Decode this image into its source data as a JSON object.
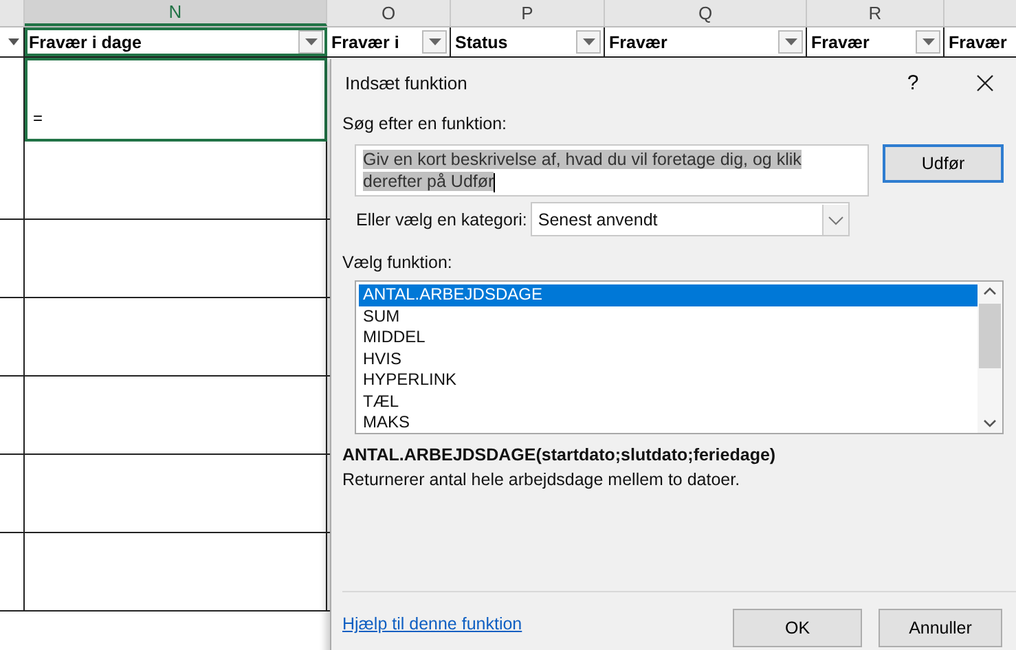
{
  "sheet": {
    "column_letters": [
      {
        "letter": "N",
        "selected": true
      },
      {
        "letter": "O",
        "selected": false
      },
      {
        "letter": "P",
        "selected": false
      },
      {
        "letter": "Q",
        "selected": false
      },
      {
        "letter": "R",
        "selected": false
      }
    ],
    "headers": [
      {
        "label": "Fravær i dage",
        "selected": true
      },
      {
        "label": "Fravær i",
        "selected": false
      },
      {
        "label": "Status",
        "selected": false
      },
      {
        "label": "Fravær",
        "selected": false
      },
      {
        "label": "Fravær",
        "selected": false
      },
      {
        "label": "Fravær",
        "selected": false
      }
    ],
    "active_cell": {
      "value": "="
    }
  },
  "dialog": {
    "title": "Indsæt funktion",
    "help_button": "?",
    "search_label": "Søg efter en funktion:",
    "search_value": "Giv en kort beskrivelse af, hvad du vil foretage dig, og klik derefter på Udfør",
    "go_button": "Udfør",
    "category_label": "Eller vælg en kategori:",
    "category_value": "Senest anvendt",
    "function_label": "Vælg funktion:",
    "functions": [
      {
        "name": "ANTAL.ARBEJDSDAGE",
        "selected": true
      },
      {
        "name": "SUM",
        "selected": false
      },
      {
        "name": "MIDDEL",
        "selected": false
      },
      {
        "name": "HVIS",
        "selected": false
      },
      {
        "name": "HYPERLINK",
        "selected": false
      },
      {
        "name": "TÆL",
        "selected": false
      },
      {
        "name": "MAKS",
        "selected": false
      }
    ],
    "signature": "ANTAL.ARBEJDSDAGE(startdato;slutdato;feriedage)",
    "description": "Returnerer antal hele arbejdsdage mellem to datoer.",
    "help_link": "Hjælp til denne funktion",
    "buttons": [
      "OK",
      "Annuller"
    ]
  }
}
